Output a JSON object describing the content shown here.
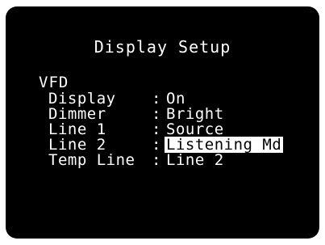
{
  "screen": {
    "title": "Display Setup",
    "section": "VFD",
    "rows": [
      {
        "label": "Display",
        "colon": ":",
        "value": "On"
      },
      {
        "label": "Dimmer",
        "colon": ":",
        "value": "Bright"
      },
      {
        "label": "Line 1",
        "colon": ":",
        "value": "Source"
      },
      {
        "label": "Line 2",
        "colon": ":",
        "value": "Listening Md"
      },
      {
        "label": "Temp Line",
        "colon": ":",
        "value": "Line 2"
      }
    ],
    "selected_row": 3
  },
  "colors": {
    "background": "#000000",
    "text": "#ffffff",
    "highlight_bg": "#ffffff",
    "highlight_text": "#000000"
  }
}
